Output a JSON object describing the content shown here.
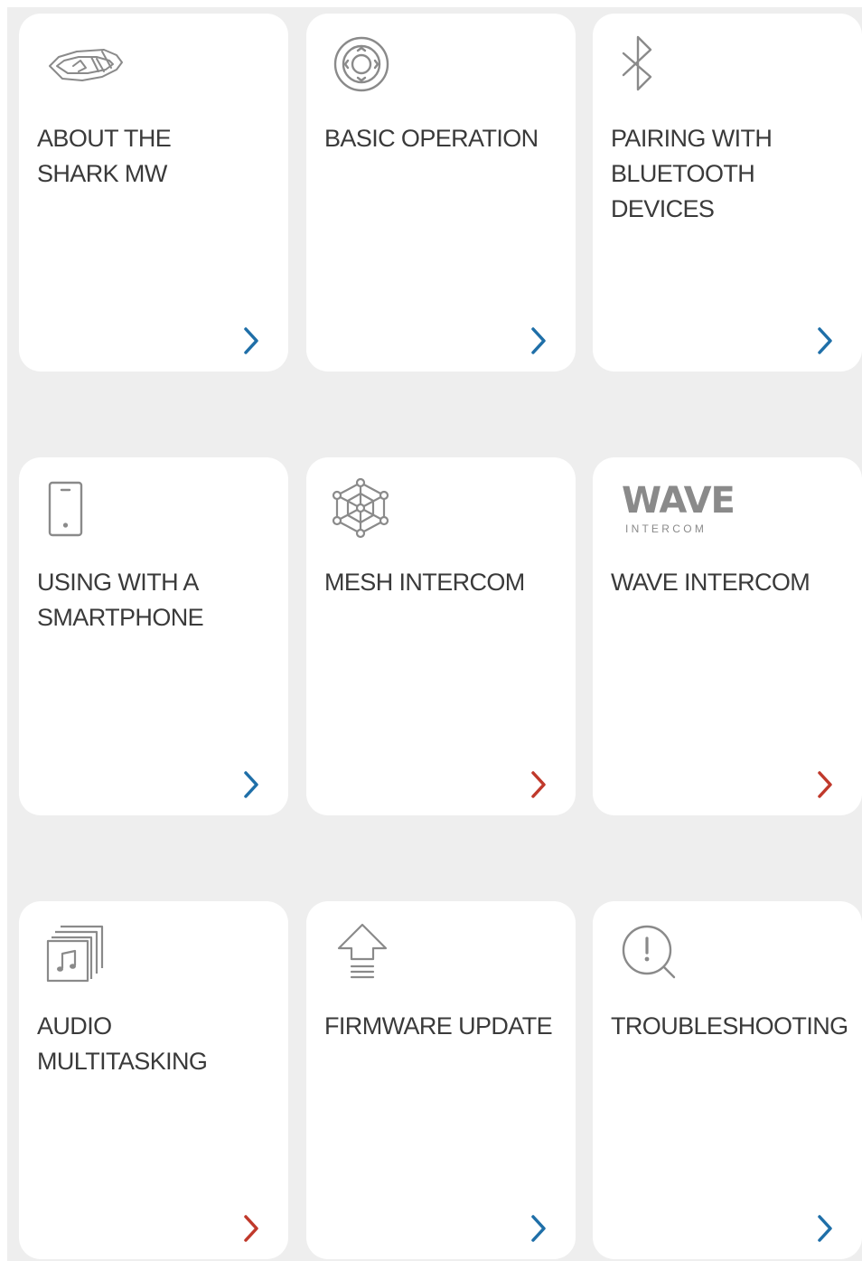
{
  "colors": {
    "background": "#eeeeee",
    "card": "#ffffff",
    "text": "#3a3a3a",
    "icon_stroke": "#8a8a8a",
    "chevron_blue": "#1f6fa8",
    "chevron_red": "#c0392b"
  },
  "cards": [
    {
      "label": "ABOUT THE\nSHARK MW",
      "icon": "helmet-headset-icon",
      "chevron_color": "blue"
    },
    {
      "label": "BASIC OPERATION",
      "icon": "control-dial-icon",
      "chevron_color": "blue"
    },
    {
      "label": "PAIRING WITH\nBLUETOOTH\nDEVICES",
      "icon": "bluetooth-icon",
      "chevron_color": "blue"
    },
    {
      "label": "USING WITH A\nSMARTPHONE",
      "icon": "smartphone-icon",
      "chevron_color": "blue"
    },
    {
      "label": "MESH INTERCOM",
      "icon": "mesh-network-icon",
      "chevron_color": "red"
    },
    {
      "label": "WAVE INTERCOM",
      "icon": "wave-intercom-logo",
      "chevron_color": "red"
    },
    {
      "label": "AUDIO\nMULTITASKING",
      "icon": "music-stack-icon",
      "chevron_color": "red"
    },
    {
      "label": "FIRMWARE UPDATE",
      "icon": "upload-arrow-icon",
      "chevron_color": "blue"
    },
    {
      "label": "TROUBLESHOOTING",
      "icon": "search-alert-icon",
      "chevron_color": "blue"
    }
  ],
  "wave_logo": {
    "word": "WAVE",
    "sub": "I N T E R C O M"
  }
}
